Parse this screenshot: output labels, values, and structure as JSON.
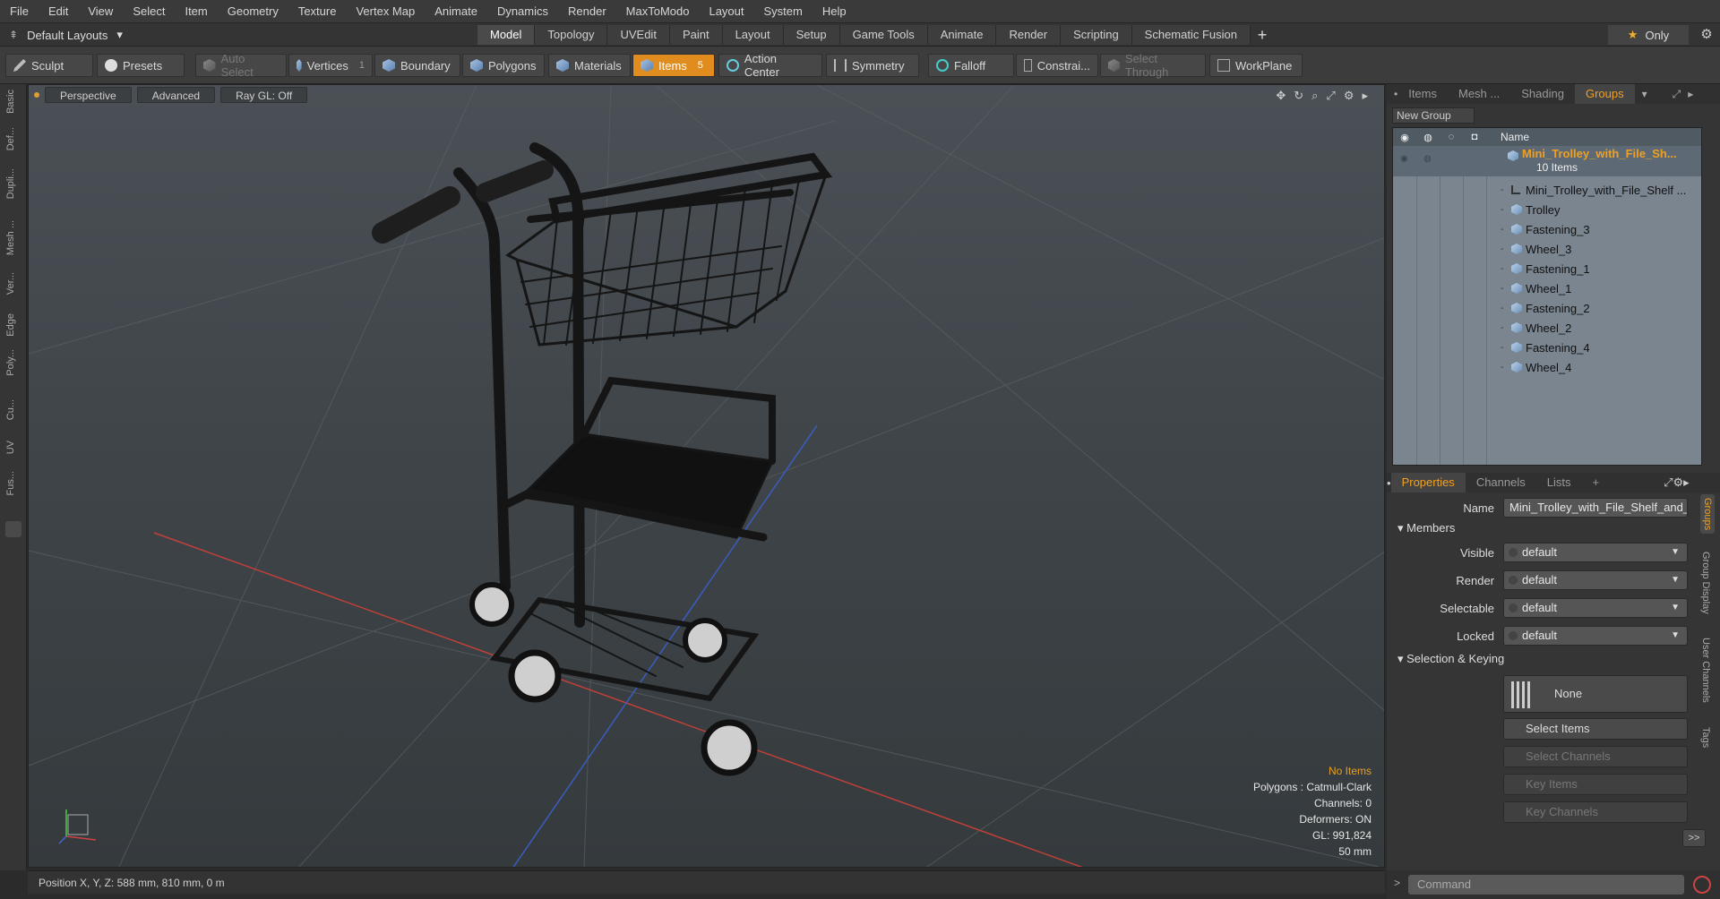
{
  "menu": [
    "File",
    "Edit",
    "View",
    "Select",
    "Item",
    "Geometry",
    "Texture",
    "Vertex Map",
    "Animate",
    "Dynamics",
    "Render",
    "MaxToModo",
    "Layout",
    "System",
    "Help"
  ],
  "layouts": {
    "label": "Default Layouts",
    "arrow": "▾"
  },
  "tabs": [
    "Model",
    "Topology",
    "UVEdit",
    "Paint",
    "Layout",
    "Setup",
    "Game Tools",
    "Animate",
    "Render",
    "Scripting",
    "Schematic Fusion"
  ],
  "active_tab": "Model",
  "only_label": "Only",
  "toolbar": {
    "sculpt": "Sculpt",
    "presets": "Presets",
    "auto_select": "Auto Select",
    "vertices": "Vertices",
    "vertices_count": "1",
    "boundary": "Boundary",
    "polygons": "Polygons",
    "materials": "Materials",
    "items": "Items",
    "items_count": "5",
    "action_center": "Action Center",
    "symmetry": "Symmetry",
    "falloff": "Falloff",
    "constrain": "Constrai...",
    "select_through": "Select Through",
    "workplane": "WorkPlane"
  },
  "left_strip": [
    "Basic",
    "Def...",
    "Dupli...",
    "Mesh ...",
    "Ver...",
    "Edge",
    "Poly...",
    "Cu...",
    "UV",
    "Fus..."
  ],
  "viewport": {
    "view": "Perspective",
    "advanced": "Advanced",
    "raygl": "Ray GL: Off",
    "info": {
      "no_items": "No Items",
      "polygons": "Polygons : Catmull-Clark",
      "channels": "Channels: 0",
      "deformers": "Deformers: ON",
      "gl": "GL: 991,824",
      "scale": "50 mm"
    }
  },
  "status": "Position X, Y, Z:   588 mm, 810 mm, 0 m",
  "right_tabs": [
    "Items",
    "Mesh ...",
    "Shading",
    "Groups"
  ],
  "active_right_tab": "Groups",
  "new_group": "New Group",
  "tree": {
    "name_header": "Name",
    "group_name": "Mini_Trolley_with_File_Sh...",
    "group_count": "10 Items",
    "items": [
      "Mini_Trolley_with_File_Shelf ...",
      "Trolley",
      "Fastening_3",
      "Wheel_3",
      "Fastening_1",
      "Wheel_1",
      "Fastening_2",
      "Wheel_2",
      "Fastening_4",
      "Wheel_4"
    ]
  },
  "prop_tabs": [
    "Properties",
    "Channels",
    "Lists"
  ],
  "props": {
    "name_label": "Name",
    "name_value": "Mini_Trolley_with_File_Shelf_and_",
    "members": "Members",
    "visible_label": "Visible",
    "visible": "default",
    "render_label": "Render",
    "render": "default",
    "selectable_label": "Selectable",
    "selectable": "default",
    "locked_label": "Locked",
    "locked": "default",
    "sel_keying": "Selection & Keying",
    "none": "None",
    "select_items": "Select Items",
    "select_channels": "Select Channels",
    "key_items": "Key Items",
    "key_channels": "Key Channels",
    "expand": ">>"
  },
  "side_vtabs": [
    "Groups",
    "Group Display",
    "User Channels",
    "Tags"
  ],
  "command_placeholder": "Command",
  "colors": {
    "accent": "#e08c1e",
    "highlight_text": "#f0a020"
  }
}
